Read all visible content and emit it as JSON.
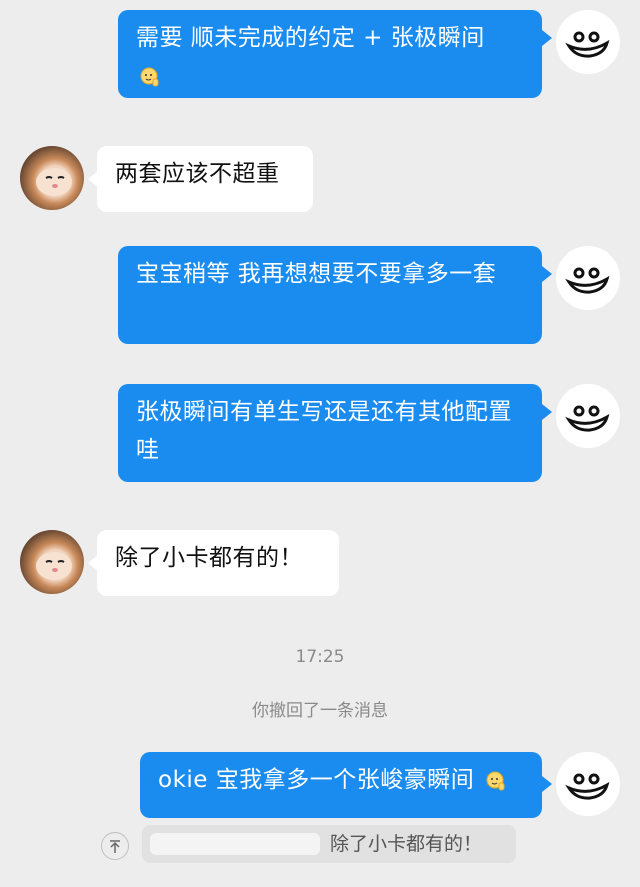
{
  "messages": [
    {
      "side": "out",
      "text": "需要 顺未完成的约定 + 张极瞬间",
      "emoji": "hand-raise-emoji"
    },
    {
      "side": "in",
      "text": "两套应该不超重"
    },
    {
      "side": "out",
      "text": "宝宝稍等 我再想想要不要拿多一套"
    },
    {
      "side": "out",
      "text": "张极瞬间有单生写还是还有其他配置哇"
    },
    {
      "side": "in",
      "text": "除了小卡都有的！"
    },
    {
      "side": "out",
      "text": "okie 宝我拿多一个张峻豪瞬间",
      "emoji": "hand-raise-emoji"
    }
  ],
  "timestamp": "17:25",
  "recall_notice": "你撤回了一条消息",
  "quote": {
    "text": "除了小卡都有的！"
  },
  "colors": {
    "background": "#ededed",
    "outgoing_bubble": "#1a8cf0",
    "incoming_bubble": "#ffffff",
    "system_text": "#8a8a8a"
  },
  "icons": {
    "my_avatar": "smiley-doodle-avatar",
    "friend_avatar": "hamster-photo-avatar",
    "quote_jump": "arrow-up-icon"
  }
}
